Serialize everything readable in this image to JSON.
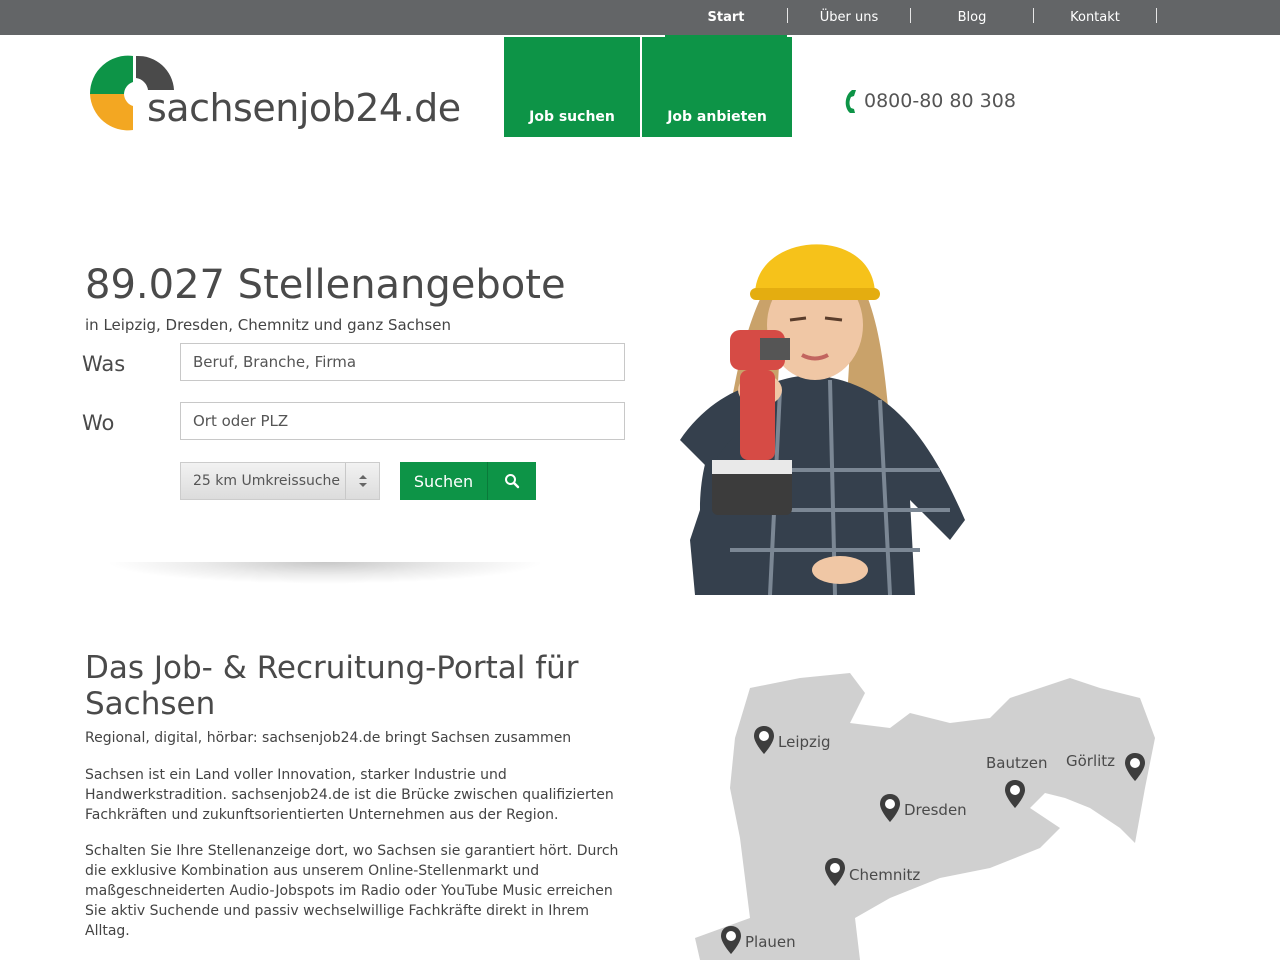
{
  "topnav": {
    "items": [
      {
        "label": "Start",
        "active": true
      },
      {
        "label": "Über uns"
      },
      {
        "label": "Blog"
      },
      {
        "label": "Kontakt"
      }
    ]
  },
  "brand": {
    "name": "sachsenjob24.de",
    "green": "#0d9447",
    "orange": "#f3a722",
    "dark": "#4a4a4a"
  },
  "mainnav": {
    "job_search": "Job suchen",
    "job_offer": "Job anbieten"
  },
  "phone": {
    "number": "0800-80 80 308",
    "icon": "phone-icon"
  },
  "hero": {
    "count": "89.027 Stellenangebote",
    "subtitle": "in Leipzig, Dresden, Chemnitz und ganz Sachsen",
    "was_label": "Was",
    "was_placeholder": "Beruf, Branche, Firma",
    "wo_label": "Wo",
    "wo_placeholder": "Ort oder PLZ",
    "radius": "25 km Umkreissuche",
    "search_button": "Suchen"
  },
  "intro": {
    "title": "Das Job- & Recruitung-Portal für Sachsen",
    "subtitle": "Regional, digital, hörbar: sachsenjob24.de bringt Sachsen zusammen",
    "p1": "Sachsen ist ein Land voller Innovation, starker Industrie und Handwerkstradition. sachsenjob24.de ist die Brücke zwischen qualifizierten Fachkräften und zukunftsorientierten Unternehmen aus der Region.",
    "p2": "Schalten Sie Ihre Stellenanzeige dort, wo Sachsen sie garantiert hört. Durch die exklusive Kombination aus unserem Online-Stellenmarkt und maßgeschneiderten Audio-Jobspots im Radio oder YouTube Music erreichen Sie aktiv Suchende und passiv wechselwillige Fachkräfte direkt in Ihrem Alltag."
  },
  "map": {
    "cities": [
      "Leipzig",
      "Bautzen",
      "Görlitz",
      "Dresden",
      "Chemnitz",
      "Plauen"
    ]
  }
}
